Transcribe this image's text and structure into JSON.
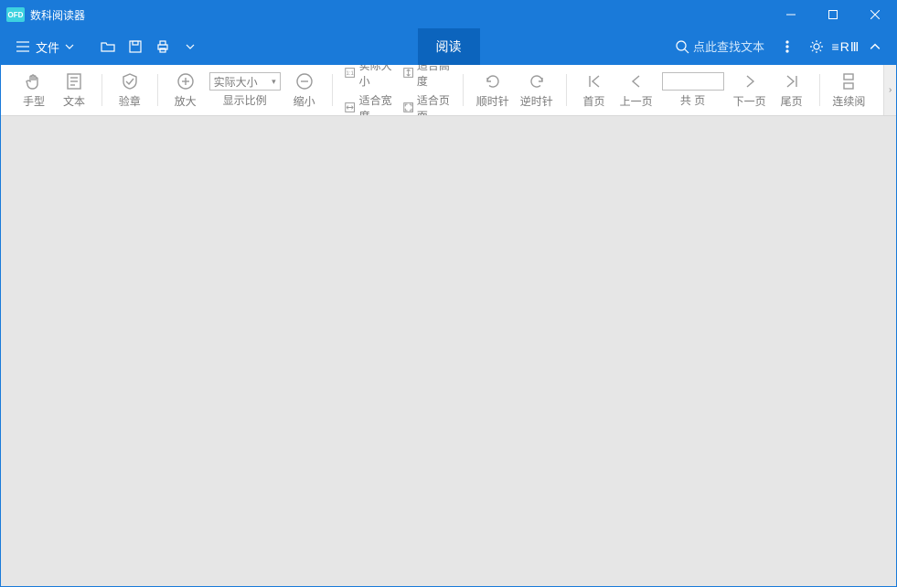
{
  "titlebar": {
    "app_name": "数科阅读器",
    "logo_text": "OFD"
  },
  "menubar": {
    "file_label": "文件",
    "active_tab": "阅读",
    "search_placeholder": "点此查找文本",
    "r_mark": "≡RⅢ"
  },
  "toolbar": {
    "hand_tool": "手型",
    "text_tool": "文本",
    "verify_seal": "验章",
    "zoom_in": "放大",
    "zoom_select_value": "实际大小",
    "zoom_label": "显示比例",
    "zoom_out": "缩小",
    "fit_actual": "实际大小",
    "fit_height": "适合高度",
    "fit_width": "适合宽度",
    "fit_page": "适合页面",
    "rotate_cw": "顺时针",
    "rotate_ccw": "逆时针",
    "first_page": "首页",
    "prev_page": "上一页",
    "page_total_label": "共 页",
    "page_input_value": "",
    "next_page": "下一页",
    "last_page": "尾页",
    "continuous": "连续阅"
  }
}
